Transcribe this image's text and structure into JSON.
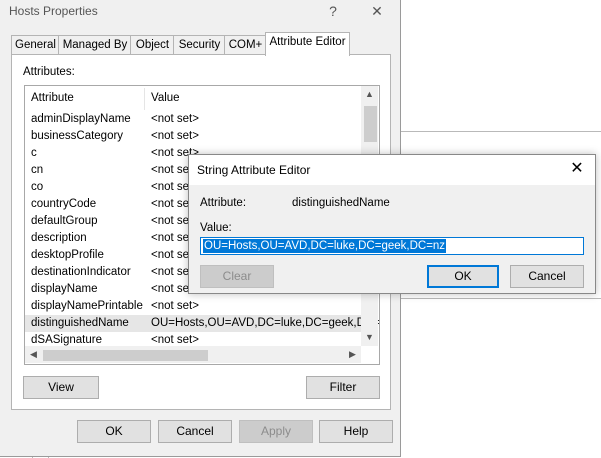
{
  "props_dialog": {
    "title": "Hosts Properties",
    "help_btn": "?",
    "close_btn": "✕",
    "tabs": [
      "General",
      "Managed By",
      "Object",
      "Security",
      "COM+",
      "Attribute Editor"
    ],
    "active_tab": "Attribute Editor",
    "attributes_label": "Attributes:",
    "columns": {
      "attribute": "Attribute",
      "value": "Value"
    },
    "rows": [
      {
        "name": "adminDisplayName",
        "value": "<not set>"
      },
      {
        "name": "businessCategory",
        "value": "<not set>"
      },
      {
        "name": "c",
        "value": "<not set>"
      },
      {
        "name": "cn",
        "value": "<not set>"
      },
      {
        "name": "co",
        "value": "<not set>"
      },
      {
        "name": "countryCode",
        "value": "<not set>"
      },
      {
        "name": "defaultGroup",
        "value": "<not set>"
      },
      {
        "name": "description",
        "value": "<not set>"
      },
      {
        "name": "desktopProfile",
        "value": "<not set>"
      },
      {
        "name": "destinationIndicator",
        "value": "<not set>"
      },
      {
        "name": "displayName",
        "value": "<not set>"
      },
      {
        "name": "displayNamePrintable",
        "value": "<not set>"
      },
      {
        "name": "distinguishedName",
        "value": "OU=Hosts,OU=AVD,DC=luke,DC=geek,DC="
      },
      {
        "name": "dSASignature",
        "value": "<not set>"
      }
    ],
    "selected_row": "distinguishedName",
    "view_btn": "View",
    "filter_btn": "Filter",
    "ok_btn": "OK",
    "cancel_btn": "Cancel",
    "apply_btn": "Apply",
    "help_button_label": "Help"
  },
  "string_editor": {
    "title": "String Attribute Editor",
    "close_btn": "✕",
    "attribute_label": "Attribute:",
    "attribute_value": "distinguishedName",
    "value_label": "Value:",
    "value_text": "OU=Hosts,OU=AVD,DC=luke,DC=geek,DC=nz",
    "clear_btn": "Clear",
    "ok_btn": "OK",
    "cancel_btn": "Cancel"
  },
  "colors": {
    "accent": "#0078d7",
    "dialog_bg": "#f0f0f0"
  }
}
